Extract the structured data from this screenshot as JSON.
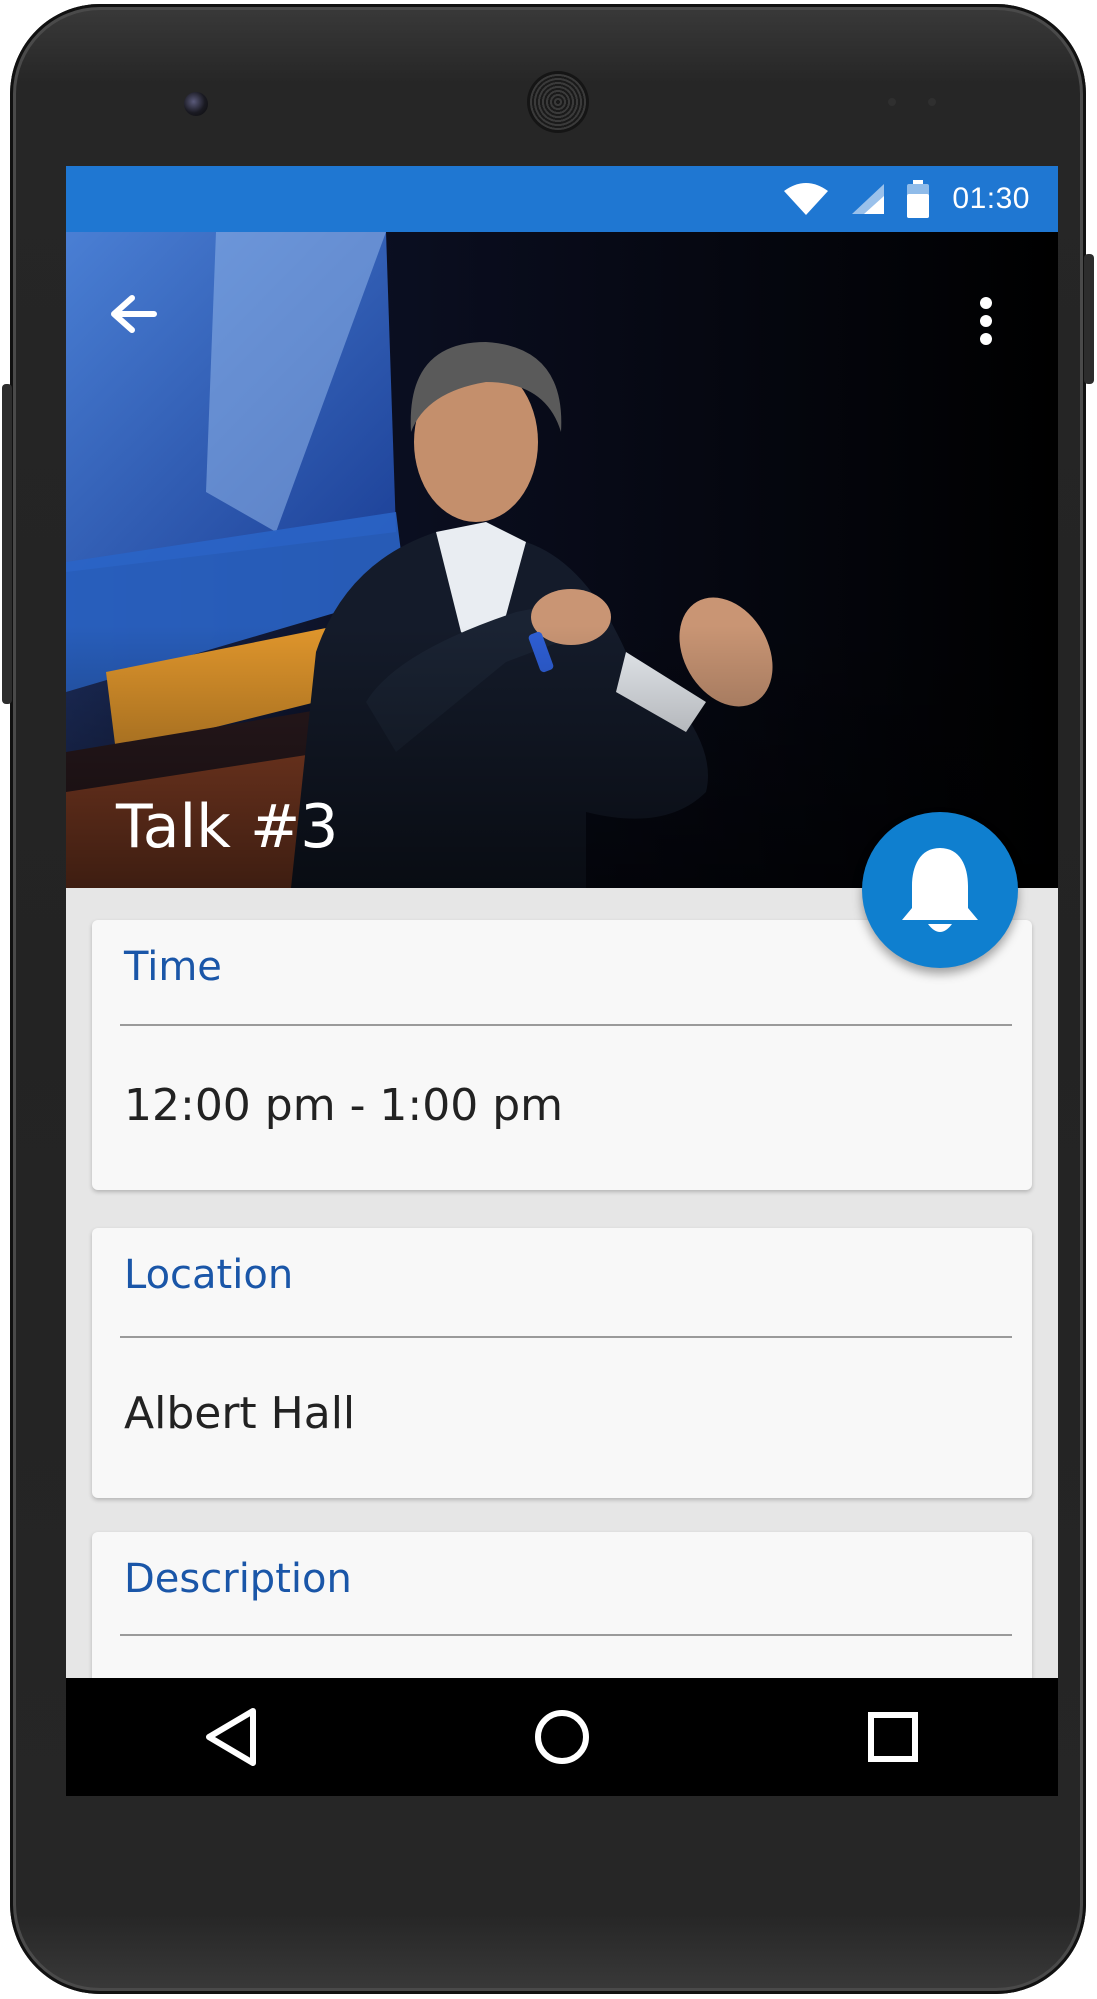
{
  "status_bar": {
    "time": "01:30",
    "wifi_icon": "wifi-icon",
    "signal_icon": "signal-icon",
    "battery_icon": "battery-icon",
    "color": "#1f77d2"
  },
  "header": {
    "title": "Talk #3",
    "back_icon": "arrow-left-icon",
    "menu_icon": "more-vert-icon"
  },
  "fab": {
    "icon": "bell-icon",
    "color": "#0f7fcf"
  },
  "details": [
    {
      "label": "Time",
      "value": "12:00 pm - 1:00 pm"
    },
    {
      "label": "Location",
      "value": "Albert Hall"
    },
    {
      "label": "Description",
      "value": ""
    }
  ],
  "nav_bar": {
    "back_icon": "nav-back-icon",
    "home_icon": "nav-home-icon",
    "recents_icon": "nav-recents-icon"
  },
  "accent_color": "#1a56a8"
}
